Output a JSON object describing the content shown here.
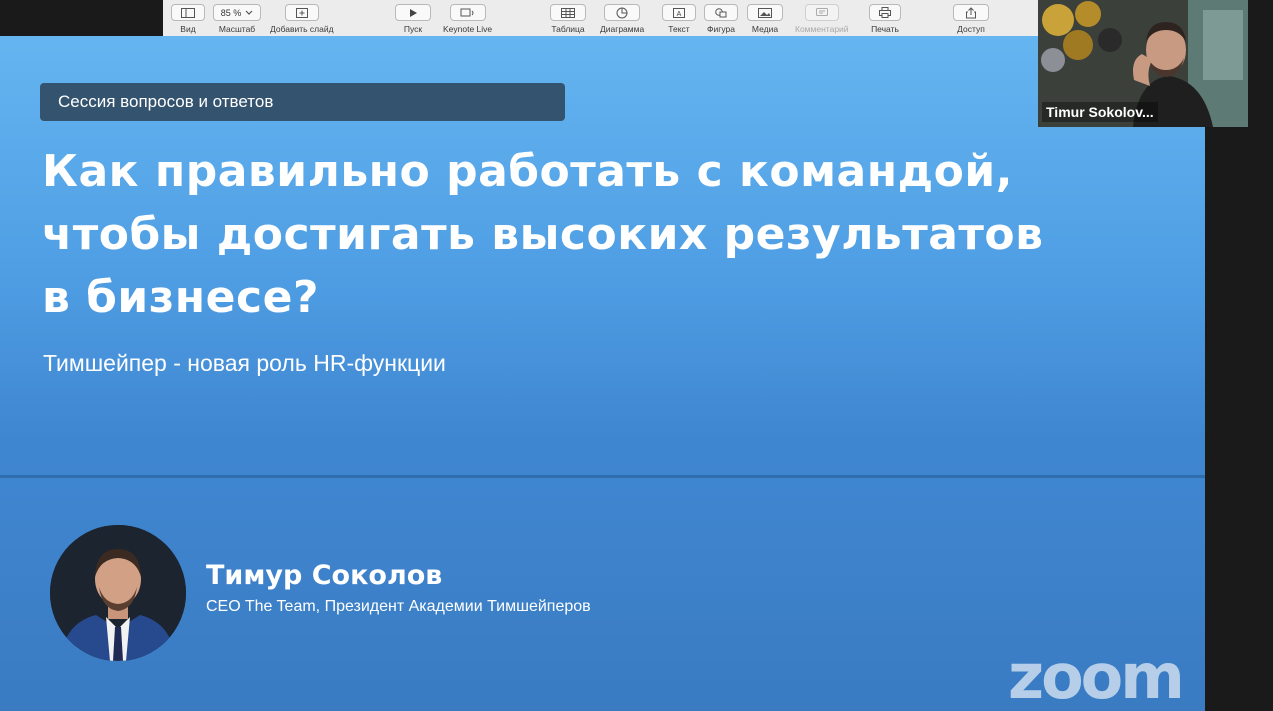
{
  "toolbar": {
    "items": [
      {
        "label": "Вид",
        "icon": "sidebar-icon"
      },
      {
        "label": "Масштаб",
        "value": "85 %",
        "icon": "chevron-down-icon"
      },
      {
        "label": "Добавить слайд",
        "icon": "plus-icon"
      },
      {
        "label": "Пуск",
        "icon": "play-icon"
      },
      {
        "label": "Keynote Live",
        "icon": "keynote-live-icon"
      },
      {
        "label": "Таблица",
        "icon": "table-icon"
      },
      {
        "label": "Диаграмма",
        "icon": "chart-icon"
      },
      {
        "label": "Текст",
        "icon": "text-box-icon"
      },
      {
        "label": "Фигура",
        "icon": "shape-icon"
      },
      {
        "label": "Медиа",
        "icon": "media-icon"
      },
      {
        "label": "Комментарий",
        "icon": "comment-icon",
        "disabled": true
      },
      {
        "label": "Печать",
        "icon": "print-icon"
      },
      {
        "label": "Доступ",
        "icon": "share-icon"
      }
    ]
  },
  "slide": {
    "badge": "Сессия вопросов и ответов",
    "title_lines": [
      "Как правильно работать с командой,",
      "чтобы достигать высоких результатов",
      "в бизнесе?"
    ],
    "subtitle": "Тимшейпер - новая роль HR-функции",
    "speaker_name": "Тимур Соколов",
    "speaker_role": "CEO The Team, Президент Академии Тимшейперов"
  },
  "webcam": {
    "participant_name": "Timur Sokolov..."
  },
  "watermark": "zoom",
  "colors": {
    "slide_top": "#65b5f1",
    "slide_bottom": "#3c7fc8",
    "badge_bg": "#34536f",
    "toolbar_bg": "#ececec"
  }
}
